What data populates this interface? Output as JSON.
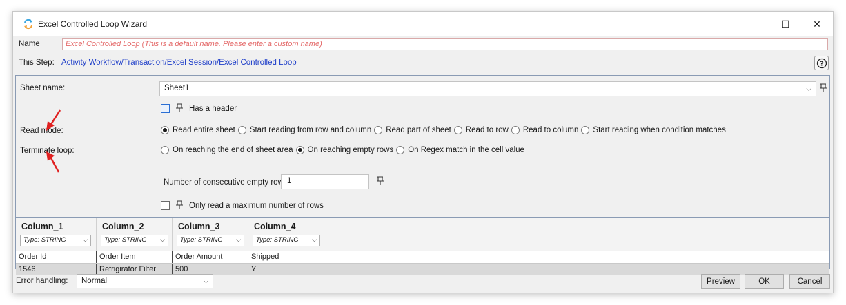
{
  "window": {
    "title": "Excel Controlled Loop Wizard",
    "minimize": "—",
    "maximize": "☐",
    "close": "✕"
  },
  "name_row": {
    "label": "Name",
    "value": "Excel Controlled Loop  (This is a default name. Please enter a custom name)"
  },
  "step_row": {
    "label": "This Step:",
    "path": "Activity Workflow/Transaction/Excel Session/Excel Controlled Loop",
    "help": "?"
  },
  "sheet": {
    "label": "Sheet name:",
    "value": "Sheet1",
    "has_header_label": "Has a header"
  },
  "read_mode": {
    "label": "Read mode:",
    "options": [
      {
        "label": "Read entire sheet",
        "selected": true
      },
      {
        "label": "Start reading from row and column",
        "selected": false
      },
      {
        "label": "Read part of sheet",
        "selected": false
      },
      {
        "label": "Read to row",
        "selected": false
      },
      {
        "label": "Read to column",
        "selected": false
      },
      {
        "label": "Start reading when condition matches",
        "selected": false
      }
    ]
  },
  "terminate": {
    "label": "Terminate loop:",
    "options": [
      {
        "label": "On reaching the end of sheet area",
        "selected": false
      },
      {
        "label": "On reaching empty rows",
        "selected": true
      },
      {
        "label": "On Regex match in the cell value",
        "selected": false
      }
    ],
    "empty_rows_label": "Number of consecutive empty rows:",
    "empty_rows_value": "1",
    "max_rows_label": "Only read a maximum number of rows"
  },
  "grid": {
    "columns": [
      {
        "name": "Column_1",
        "type": "Type: STRING"
      },
      {
        "name": "Column_2",
        "type": "Type: STRING"
      },
      {
        "name": "Column_3",
        "type": "Type: STRING"
      },
      {
        "name": "Column_4",
        "type": "Type: STRING"
      }
    ],
    "rows": [
      [
        "Order Id",
        "Order Item",
        "Order Amount",
        "Shipped"
      ],
      [
        "1546",
        "Refrigirator Filter",
        "500",
        "Y"
      ]
    ]
  },
  "footer": {
    "error_label": "Error handling:",
    "error_value": "Normal",
    "preview": "Preview",
    "ok": "OK",
    "cancel": "Cancel"
  },
  "colors": {
    "accent_link": "#1f3fc9",
    "default_name_text": "#e46a6a",
    "annotation_arrow": "#e02020"
  },
  "icons": [
    "app-loop-icon",
    "pin-icon",
    "help-icon",
    "chevron-down-icon",
    "red-arrow-annotation"
  ]
}
